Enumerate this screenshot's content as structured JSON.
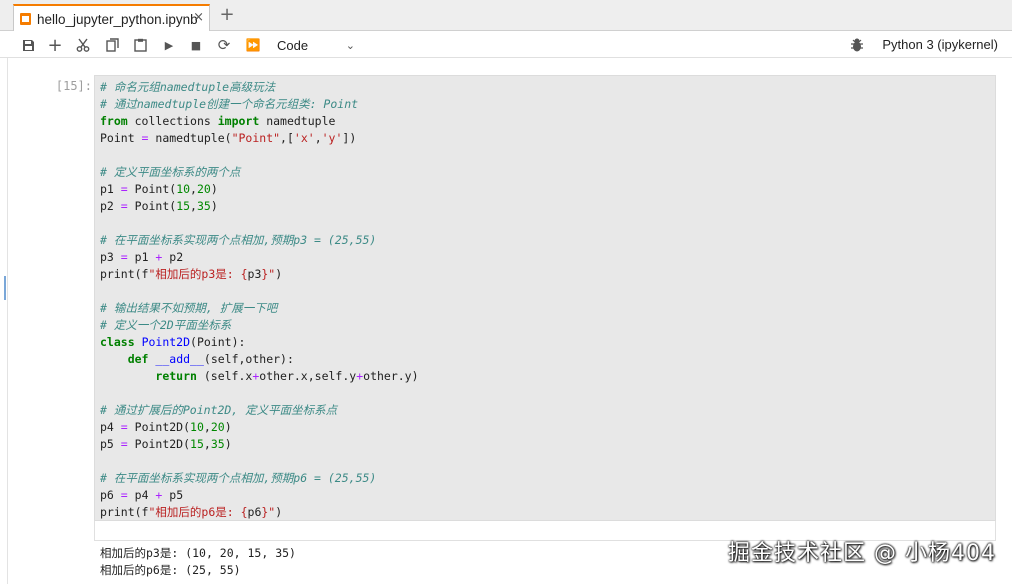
{
  "tab": {
    "title": "hello_jupyter_python.ipynb",
    "close": "×",
    "add": "+"
  },
  "toolbar": {
    "save": "save-icon",
    "insert": "+",
    "cut": "cut-icon",
    "copy": "copy-icon",
    "paste": "paste-icon",
    "run": "▶",
    "stop": "■",
    "restart": "⟳",
    "run_all": "⏩",
    "cell_type": "Code",
    "kernel": "Python 3 (ipykernel)"
  },
  "cell": {
    "prompt": "[15]:",
    "lines": [
      [
        [
          "com",
          "# 命名元组namedtuple高级玩法"
        ]
      ],
      [
        [
          "com",
          "# 通过namedtuple创建一个命名元组类: Point"
        ]
      ],
      [
        [
          "kw",
          "from"
        ],
        [
          "txt",
          " collections "
        ],
        [
          "kw",
          "import"
        ],
        [
          "txt",
          " namedtuple"
        ]
      ],
      [
        [
          "txt",
          "Point "
        ],
        [
          "op",
          "="
        ],
        [
          "txt",
          " namedtuple("
        ],
        [
          "str",
          "\"Point\""
        ],
        [
          "txt",
          ",["
        ],
        [
          "str",
          "'x'"
        ],
        [
          "txt",
          ","
        ],
        [
          "str",
          "'y'"
        ],
        [
          "txt",
          "])"
        ]
      ],
      [],
      [
        [
          "com",
          "# 定义平面坐标系的两个点"
        ]
      ],
      [
        [
          "txt",
          "p1 "
        ],
        [
          "op",
          "="
        ],
        [
          "txt",
          " Point("
        ],
        [
          "num",
          "10"
        ],
        [
          "txt",
          ","
        ],
        [
          "num",
          "20"
        ],
        [
          "txt",
          ")"
        ]
      ],
      [
        [
          "txt",
          "p2 "
        ],
        [
          "op",
          "="
        ],
        [
          "txt",
          " Point("
        ],
        [
          "num",
          "15"
        ],
        [
          "txt",
          ","
        ],
        [
          "num",
          "35"
        ],
        [
          "txt",
          ")"
        ]
      ],
      [],
      [
        [
          "com",
          "# 在平面坐标系实现两个点相加,预期p3 = (25,55)"
        ]
      ],
      [
        [
          "txt",
          "p3 "
        ],
        [
          "op",
          "="
        ],
        [
          "txt",
          " p1 "
        ],
        [
          "op",
          "+"
        ],
        [
          "txt",
          " p2"
        ]
      ],
      [
        [
          "txt",
          "print(f"
        ],
        [
          "str",
          "\"相加后的p3是: {"
        ],
        [
          "txt",
          "p3"
        ],
        [
          "str",
          "}\""
        ],
        [
          "txt",
          ")"
        ]
      ],
      [],
      [
        [
          "com",
          "# 输出结果不如预期, 扩展一下吧"
        ]
      ],
      [
        [
          "com",
          "# 定义一个2D平面坐标系"
        ]
      ],
      [
        [
          "kw",
          "class"
        ],
        [
          "txt",
          " "
        ],
        [
          "def",
          "Point2D"
        ],
        [
          "txt",
          "(Point):"
        ]
      ],
      [
        [
          "txt",
          "    "
        ],
        [
          "kw",
          "def"
        ],
        [
          "txt",
          " "
        ],
        [
          "def",
          "__add__"
        ],
        [
          "txt",
          "(self,other):"
        ]
      ],
      [
        [
          "txt",
          "        "
        ],
        [
          "kw",
          "return"
        ],
        [
          "txt",
          " (self.x"
        ],
        [
          "op",
          "+"
        ],
        [
          "txt",
          "other.x,self.y"
        ],
        [
          "op",
          "+"
        ],
        [
          "txt",
          "other.y)"
        ]
      ],
      [],
      [
        [
          "com",
          "# 通过扩展后的Point2D, 定义平面坐标系点"
        ]
      ],
      [
        [
          "txt",
          "p4 "
        ],
        [
          "op",
          "="
        ],
        [
          "txt",
          " Point2D("
        ],
        [
          "num",
          "10"
        ],
        [
          "txt",
          ","
        ],
        [
          "num",
          "20"
        ],
        [
          "txt",
          ")"
        ]
      ],
      [
        [
          "txt",
          "p5 "
        ],
        [
          "op",
          "="
        ],
        [
          "txt",
          " Point2D("
        ],
        [
          "num",
          "15"
        ],
        [
          "txt",
          ","
        ],
        [
          "num",
          "35"
        ],
        [
          "txt",
          ")"
        ]
      ],
      [],
      [
        [
          "com",
          "# 在平面坐标系实现两个点相加,预期p6 = (25,55)"
        ]
      ],
      [
        [
          "txt",
          "p6 "
        ],
        [
          "op",
          "="
        ],
        [
          "txt",
          " p4 "
        ],
        [
          "op",
          "+"
        ],
        [
          "txt",
          " p5"
        ]
      ],
      [
        [
          "txt",
          "print(f"
        ],
        [
          "str",
          "\"相加后的p6是: {"
        ],
        [
          "txt",
          "p6"
        ],
        [
          "str",
          "}\""
        ],
        [
          "txt",
          ")"
        ]
      ]
    ]
  },
  "output": {
    "lines": [
      "相加后的p3是: (10, 20, 15, 35)",
      "相加后的p6是: (25, 55)"
    ]
  },
  "watermark": "掘金技术社区 @ 小杨404"
}
